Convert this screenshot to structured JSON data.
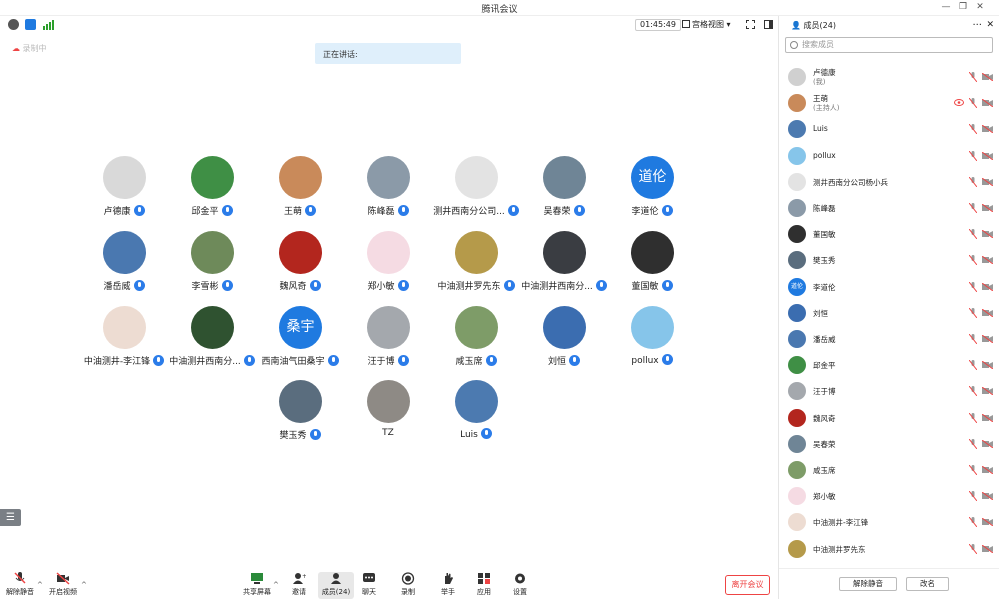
{
  "window": {
    "title": "腾讯会议"
  },
  "toolbar": {
    "timer": "01:45:49",
    "view_label": "宫格视图"
  },
  "cloud_label": "录制中",
  "speaking_label": "正在讲话:",
  "participants": [
    {
      "name": "卢德康",
      "color": "#d9d9d9"
    },
    {
      "name": "邱金平",
      "color": "#3f8f45"
    },
    {
      "name": "王萌",
      "color": "#c98a5a"
    },
    {
      "name": "陈峰磊",
      "color": "#8b9aa8"
    },
    {
      "name": "测井西南分公司...",
      "color": "#e3e3e3"
    },
    {
      "name": "吴春荣",
      "color": "#6f8596"
    },
    {
      "name": "李道伦",
      "color": "#1f7ae0",
      "text": "道伦"
    },
    {
      "name": "潘岳威",
      "color": "#4a78b0"
    },
    {
      "name": "李雪彬",
      "color": "#6e8a5a"
    },
    {
      "name": "魏风奇",
      "color": "#b3261e"
    },
    {
      "name": "郑小敏",
      "color": "#f5dbe3"
    },
    {
      "name": "中油测井罗先东",
      "color": "#b59a4a"
    },
    {
      "name": "中油测井西南分...",
      "color": "#3a3d42"
    },
    {
      "name": "董国敏",
      "color": "#2f2f2f"
    },
    {
      "name": "中油测井-李江锋",
      "color": "#eddcd2"
    },
    {
      "name": "中油测井西南分...",
      "color": "#2f5230"
    },
    {
      "name": "西南油气田桑宇",
      "color": "#1f7ae0",
      "text": "桑宇"
    },
    {
      "name": "汪于博",
      "color": "#a4a8ad"
    },
    {
      "name": "咸玉席",
      "color": "#7e9c68"
    },
    {
      "name": "刘恒",
      "color": "#3b6db0"
    },
    {
      "name": "pollux",
      "color": "#86c5ea"
    },
    {
      "name": "樊玉秀",
      "color": "#5a6d7e"
    },
    {
      "name": "TZ",
      "color": "#8e8a85",
      "nomic": true
    },
    {
      "name": "Luis",
      "color": "#4c7ab0"
    }
  ],
  "bottom": {
    "unmute": "解除静音",
    "start_video": "开启视频",
    "share": "共享屏幕",
    "invite": "邀请",
    "members": "成员(24)",
    "chat": "聊天",
    "record": "录制",
    "raise_hand": "举手",
    "apps": "应用",
    "settings": "设置",
    "leave": "离开会议"
  },
  "panel": {
    "title": "成员(24)",
    "search_placeholder": "搜索成员",
    "members": [
      {
        "name": "卢德康",
        "role": "(我)",
        "color": "#d0d0d0"
      },
      {
        "name": "王萌",
        "role": "(主持人)",
        "color": "#c98a5a",
        "view": true
      },
      {
        "name": "Luis",
        "color": "#4c7ab0"
      },
      {
        "name": "pollux",
        "color": "#86c5ea"
      },
      {
        "name": "测井西南分公司杨小兵",
        "color": "#e3e3e3"
      },
      {
        "name": "陈峰磊",
        "color": "#8b9aa8"
      },
      {
        "name": "董国敏",
        "color": "#2f2f2f"
      },
      {
        "name": "樊玉秀",
        "color": "#5a6d7e"
      },
      {
        "name": "李道伦",
        "color": "#1f7ae0",
        "text": "道伦"
      },
      {
        "name": "刘恒",
        "color": "#3b6db0"
      },
      {
        "name": "潘岳威",
        "color": "#4a78b0"
      },
      {
        "name": "邱金平",
        "color": "#3f8f45"
      },
      {
        "name": "汪于博",
        "color": "#a4a8ad"
      },
      {
        "name": "魏风奇",
        "color": "#b3261e"
      },
      {
        "name": "吴春荣",
        "color": "#6f8596"
      },
      {
        "name": "咸玉席",
        "color": "#7e9c68"
      },
      {
        "name": "郑小敏",
        "color": "#f5dbe3"
      },
      {
        "name": "中油测井-李江锋",
        "color": "#eddcd2"
      },
      {
        "name": "中油测井罗先东",
        "color": "#b59a4a"
      }
    ],
    "unmute_all": "解除静音",
    "rename": "改名"
  },
  "colors": {
    "accent": "#2b7ce9",
    "danger": "#e44444",
    "speaking_bg": "#dfeffb"
  }
}
